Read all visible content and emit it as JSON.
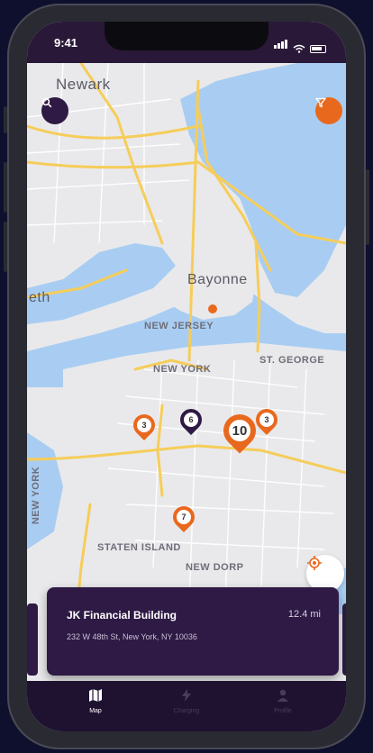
{
  "status": {
    "time": "9:41"
  },
  "map": {
    "labels": {
      "newark": "Newark",
      "bayonne": "Bayonne",
      "eth": "eth",
      "new_jersey": "NEW JERSEY",
      "new_york": "NEW YORK",
      "st_george": "ST. GEORGE",
      "new_york_vertical": "NEW YORK",
      "staten_island": "STATEN ISLAND",
      "new_dorp": "NEW DORP"
    },
    "pins": [
      {
        "count": "3",
        "color": "#e8691e"
      },
      {
        "count": "6",
        "color": "#2e1a44"
      },
      {
        "count": "10",
        "color": "#e8691e"
      },
      {
        "count": "3",
        "color": "#e8691e"
      },
      {
        "count": "7",
        "color": "#e8691e"
      }
    ],
    "colors": {
      "water": "#a9cdf2",
      "land": "#e9e9eb",
      "highway": "#f6cd5a",
      "accent": "#e8691e",
      "brand": "#2e1a44"
    },
    "icons": {
      "search": "search-icon",
      "filter": "filter-icon",
      "locate": "locate-icon"
    }
  },
  "card": {
    "title": "JK Financial Building",
    "distance": "12.4 mi",
    "address": "232 W 48th St, New York, NY 10036"
  },
  "tabs": [
    {
      "label": "Map",
      "icon": "map-icon",
      "active": true
    },
    {
      "label": "Charging",
      "icon": "lightning-icon",
      "active": false
    },
    {
      "label": "Profile",
      "icon": "user-icon",
      "active": false
    }
  ]
}
